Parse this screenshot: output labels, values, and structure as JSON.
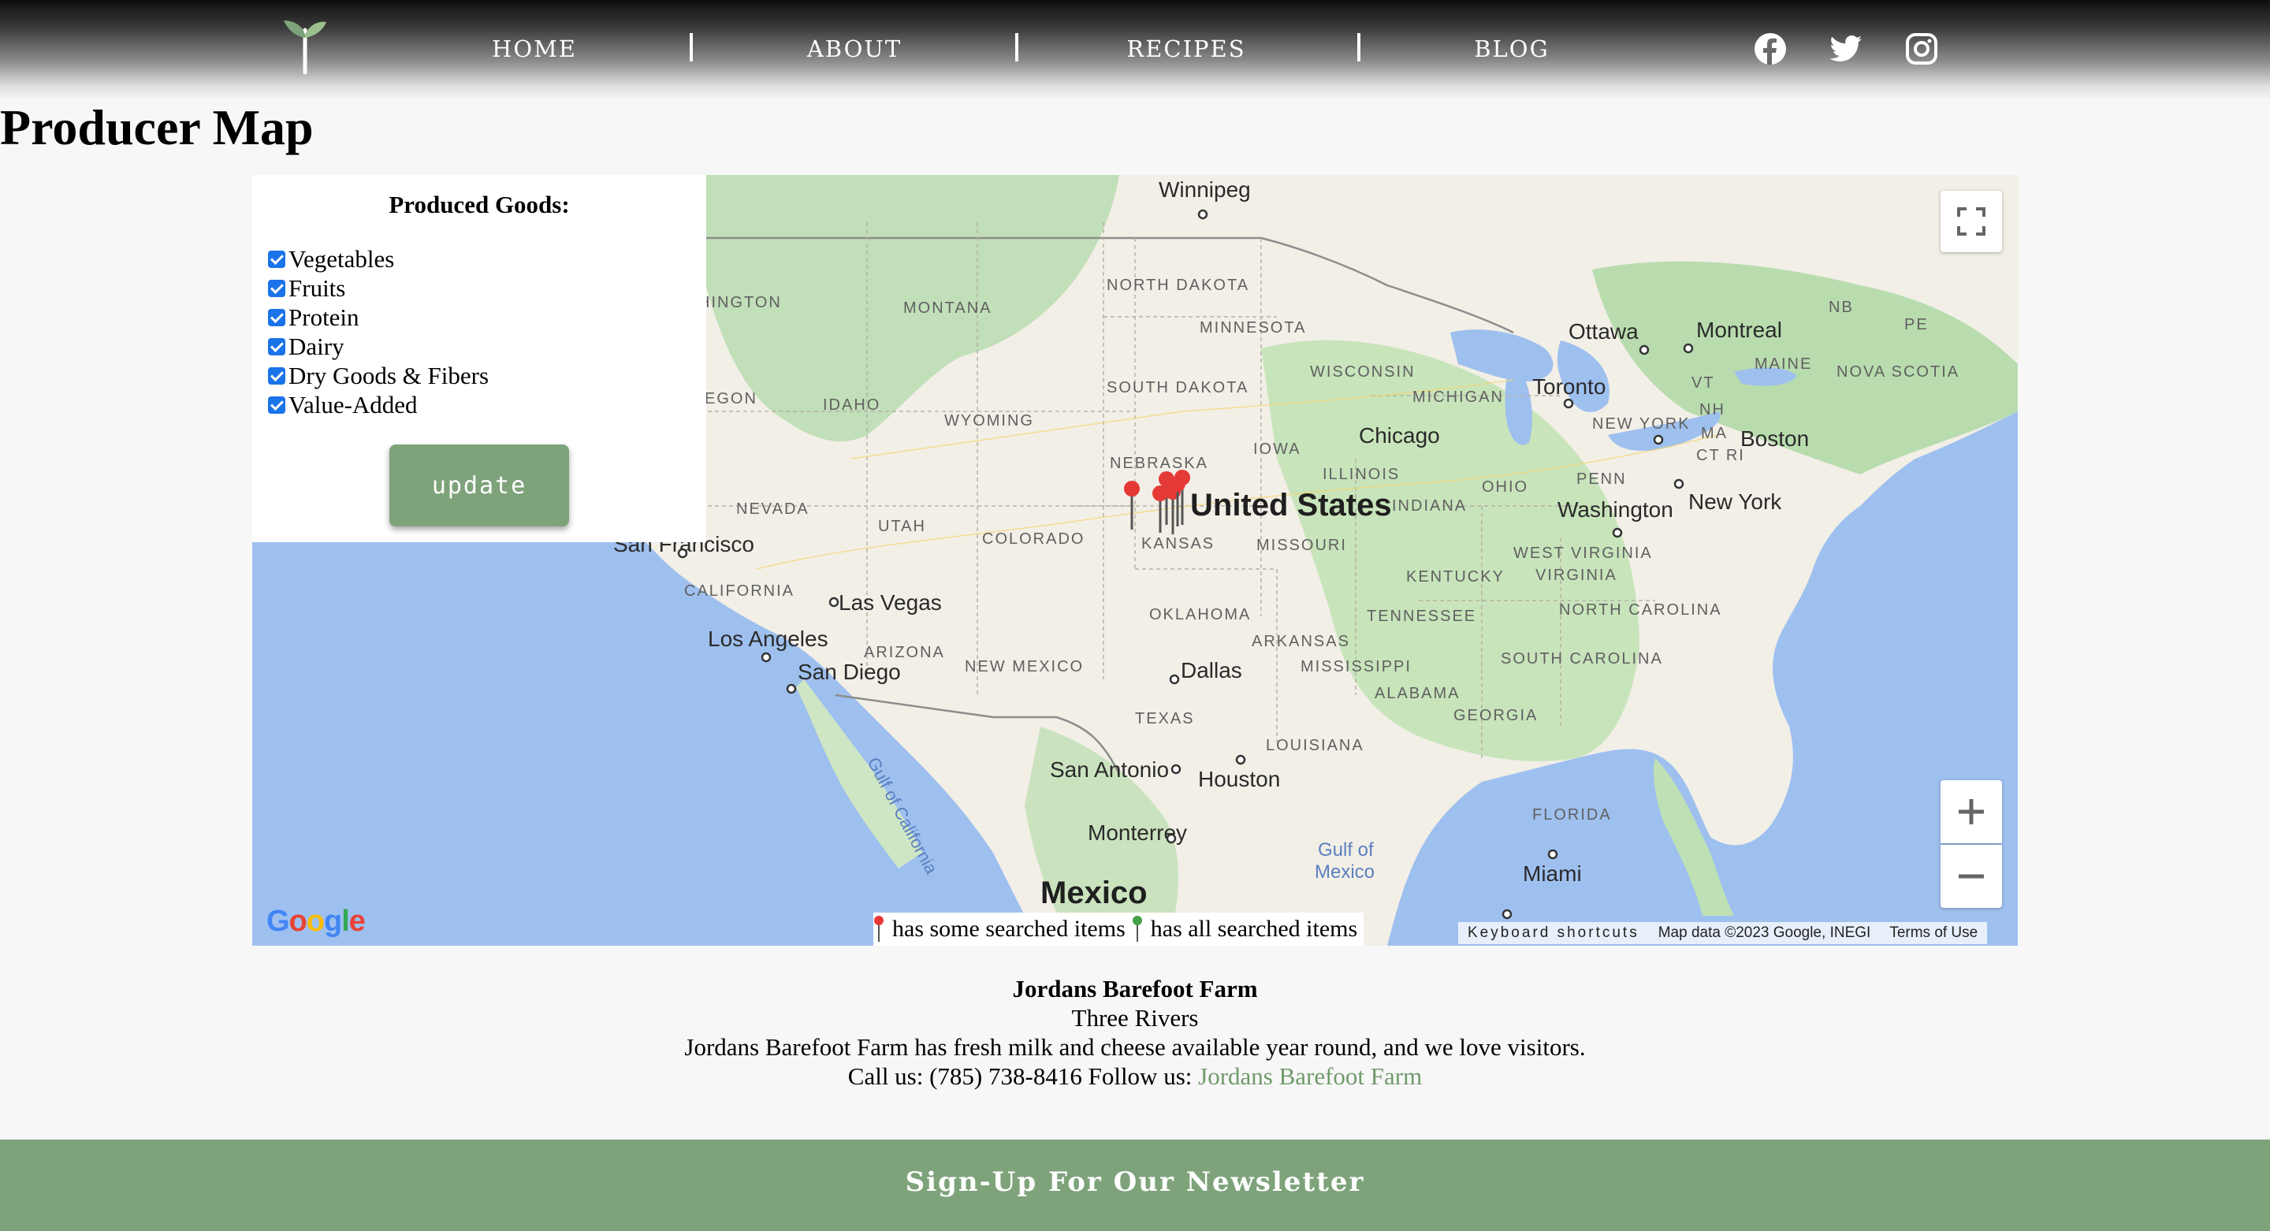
{
  "nav": {
    "links": [
      "HOME",
      "ABOUT",
      "RECIPES",
      "BLOG"
    ],
    "social": [
      "facebook-icon",
      "twitter-icon",
      "instagram-icon"
    ]
  },
  "page_title": "Producer Map",
  "filter": {
    "title": "Produced Goods:",
    "options": [
      {
        "label": "Vegetables",
        "checked": true
      },
      {
        "label": "Fruits",
        "checked": true
      },
      {
        "label": "Protein",
        "checked": true
      },
      {
        "label": "Dairy",
        "checked": true
      },
      {
        "label": "Dry Goods & Fibers",
        "checked": true
      },
      {
        "label": "Value-Added",
        "checked": true
      }
    ],
    "button": "update"
  },
  "map": {
    "labels": {
      "country": "United States",
      "mexico": "Mexico",
      "gulf": [
        "Gulf of",
        "Mexico"
      ],
      "gulf_california": "Gulf of California",
      "states": [
        "MONTANA",
        "NORTH DAKOTA",
        "SOUTH DAKOTA",
        "MINNESOTA",
        "WISCONSIN",
        "MICHIGAN",
        "IDAHO",
        "WYOMING",
        "NEBRASKA",
        "IOWA",
        "ILLINOIS",
        "INDIANA",
        "OHIO",
        "PENN",
        "NEVADA",
        "UTAH",
        "COLORADO",
        "KANSAS",
        "MISSOURI",
        "KENTUCKY",
        "WEST VIRGINIA",
        "VIRGINIA",
        "CALIFORNIA",
        "ARIZONA",
        "NEW MEXICO",
        "OKLAHOMA",
        "ARKANSAS",
        "TENNESSEE",
        "NORTH CAROLINA",
        "SOUTH CAROLINA",
        "MISSISSIPPI",
        "ALABAMA",
        "GEORGIA",
        "TEXAS",
        "LOUISIANA",
        "FLORIDA",
        "NEW YORK",
        "MAINE",
        "VT",
        "NH",
        "MA",
        "CT RI",
        "NB",
        "PE",
        "NOVA SCOTIA",
        "EGON",
        "HINGTON"
      ],
      "cities": [
        "Winnipeg",
        "Ottawa",
        "Montreal",
        "Toronto",
        "Chicago",
        "Boston",
        "New York",
        "Washington",
        "San Francisco",
        "Las Vegas",
        "Los Angeles",
        "San Diego",
        "Dallas",
        "San Antonio",
        "Houston",
        "Monterrey",
        "Miami"
      ]
    },
    "legend": {
      "some": "has some searched items",
      "all": "has all searched items"
    },
    "attribution": {
      "shortcuts": "Keyboard shortcuts",
      "data": "Map data ©2023 Google, INEGI",
      "terms": "Terms of Use"
    },
    "google": "Google",
    "colors": {
      "water": "#9ec0ef",
      "land": "#f2efe7",
      "green": "#b9dcaf",
      "marker": "#e53935"
    }
  },
  "farm": {
    "name": "Jordans Barefoot Farm",
    "location": "Three Rivers",
    "description": "Jordans Barefoot Farm has fresh milk and cheese available year round, and we love visitors.",
    "call_label": "Call us:",
    "phone": "(785) 738-8416",
    "follow_label": "Follow us:",
    "follow_link": "Jordans Barefoot Farm"
  },
  "footer": {
    "newsletter": "Sign-Up For Our Newsletter"
  },
  "colors": {
    "brand_green": "#7ea37b",
    "link_green": "#6f9a6a"
  }
}
